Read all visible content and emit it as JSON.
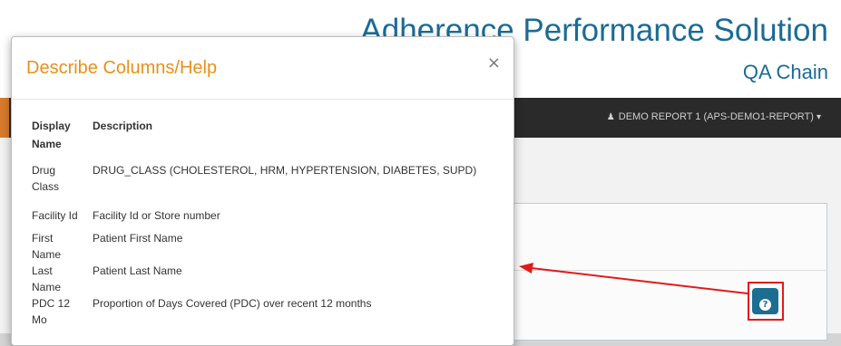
{
  "app": {
    "title": "Adherence Performance Solution",
    "subtitle": "QA Chain",
    "user_menu": "DEMO REPORT 1 (APS-DEMO1-REPORT)",
    "user_icon": "user-icon",
    "caret_icon": "caret-down-icon",
    "brand_color": "#1b6b95",
    "accent_color": "#d77a2b"
  },
  "modal": {
    "title": "Describe Columns/Help",
    "close_glyph": "×",
    "columns": {
      "name": "Display Name",
      "description": "Description"
    },
    "rows": [
      {
        "name": "Drug Class",
        "description": "DRUG_CLASS (CHOLESTEROL, HRM, HYPERTENSION, DIABETES, SUPD)"
      },
      {
        "name": "Facility Id",
        "description": "Facility Id or Store number"
      },
      {
        "name": "First Name",
        "description": "Patient First Name"
      },
      {
        "name": "Last Name",
        "description": "Patient Last Name"
      },
      {
        "name": "PDC 12 Mo",
        "description": "Proportion of Days Covered (PDC) over recent 12 months"
      }
    ]
  },
  "help_button": {
    "icon": "question-circle-icon",
    "glyph": "?",
    "highlight_color": "#e01b1b"
  }
}
